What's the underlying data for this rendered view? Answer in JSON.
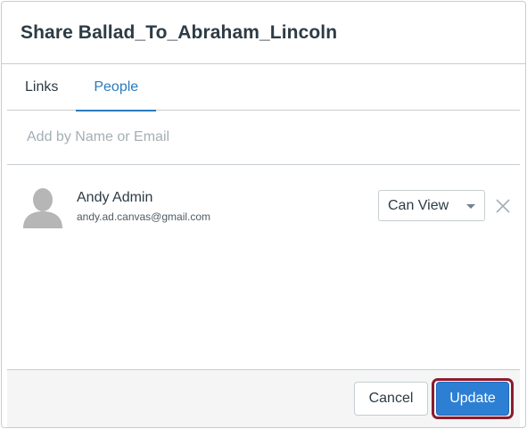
{
  "dialog": {
    "title": "Share Ballad_To_Abraham_Lincoln"
  },
  "tabs": [
    {
      "label": "Links",
      "active": false
    },
    {
      "label": "People",
      "active": true
    }
  ],
  "add_field": {
    "placeholder": "Add by Name or Email",
    "value": ""
  },
  "people": [
    {
      "name": "Andy Admin",
      "email": "andy.ad.canvas@gmail.com",
      "permission": "Can View"
    }
  ],
  "footer": {
    "cancel_label": "Cancel",
    "update_label": "Update"
  },
  "colors": {
    "accent": "#2b7abc",
    "primary_button": "#2d7fd3",
    "highlight_ring": "#8b1c2e",
    "border": "#c7cdd1"
  },
  "icons": {
    "avatar": "user-silhouette-icon",
    "dropdown": "caret-down-icon",
    "remove": "close-x-icon"
  }
}
